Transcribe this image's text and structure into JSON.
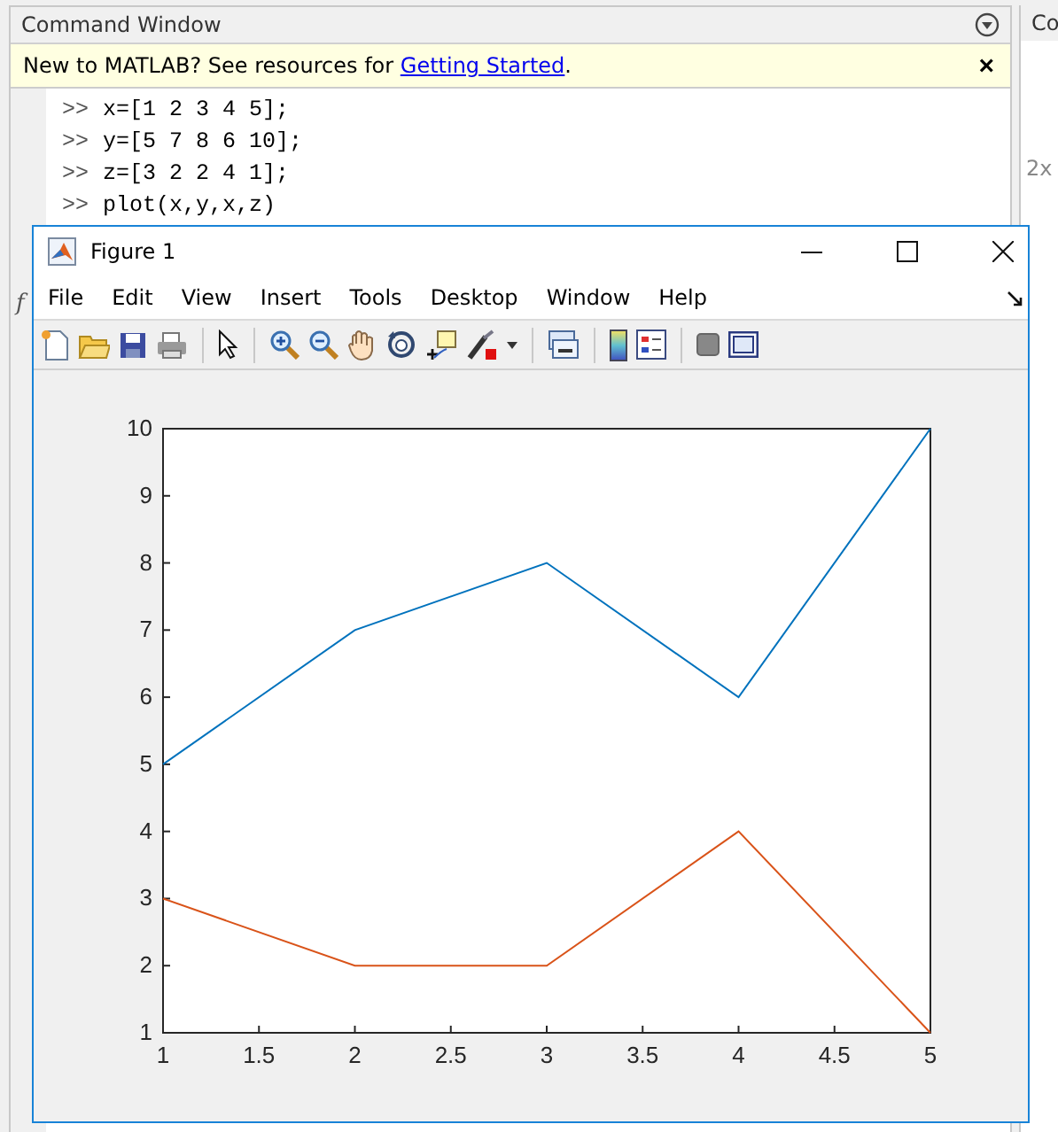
{
  "command_window": {
    "title": "Command Window",
    "notice": {
      "text": "New to MATLAB? See resources for ",
      "link": "Getting Started",
      "end": ".",
      "close": "×"
    },
    "lines": [
      {
        "prompt": ">>",
        "code": "x=[1 2 3 4 5];"
      },
      {
        "prompt": ">>",
        "code": "y=[5 7 8 6 10];"
      },
      {
        "prompt": ">>",
        "code": "z=[3 2 2 4 1];"
      },
      {
        "prompt": ">>",
        "code": "plot(x,y,x,z)"
      }
    ],
    "fx": "f"
  },
  "side_panel": {
    "title": "Co",
    "text": "2x"
  },
  "figure": {
    "title": "Figure 1",
    "menu": [
      "File",
      "Edit",
      "View",
      "Insert",
      "Tools",
      "Desktop",
      "Window",
      "Help"
    ],
    "chart_data": {
      "type": "line",
      "x": [
        1,
        2,
        3,
        4,
        5
      ],
      "xlim": [
        1,
        5
      ],
      "ylim": [
        1,
        10
      ],
      "xticks": [
        1,
        {
          "value": 1.5,
          "label": "1.5"
        },
        2,
        {
          "value": 2.5,
          "label": "2.5"
        },
        3,
        {
          "value": 3.5,
          "label": "3.5"
        },
        4,
        {
          "value": 4.5,
          "label": "4.5"
        },
        5
      ],
      "yticks": [
        1,
        2,
        3,
        4,
        5,
        6,
        7,
        8,
        9,
        10
      ],
      "series": [
        {
          "color": "#0072bd",
          "values": [
            5,
            7,
            8,
            6,
            10
          ]
        },
        {
          "color": "#d95319",
          "values": [
            3,
            2,
            2,
            4,
            1
          ]
        }
      ]
    }
  }
}
